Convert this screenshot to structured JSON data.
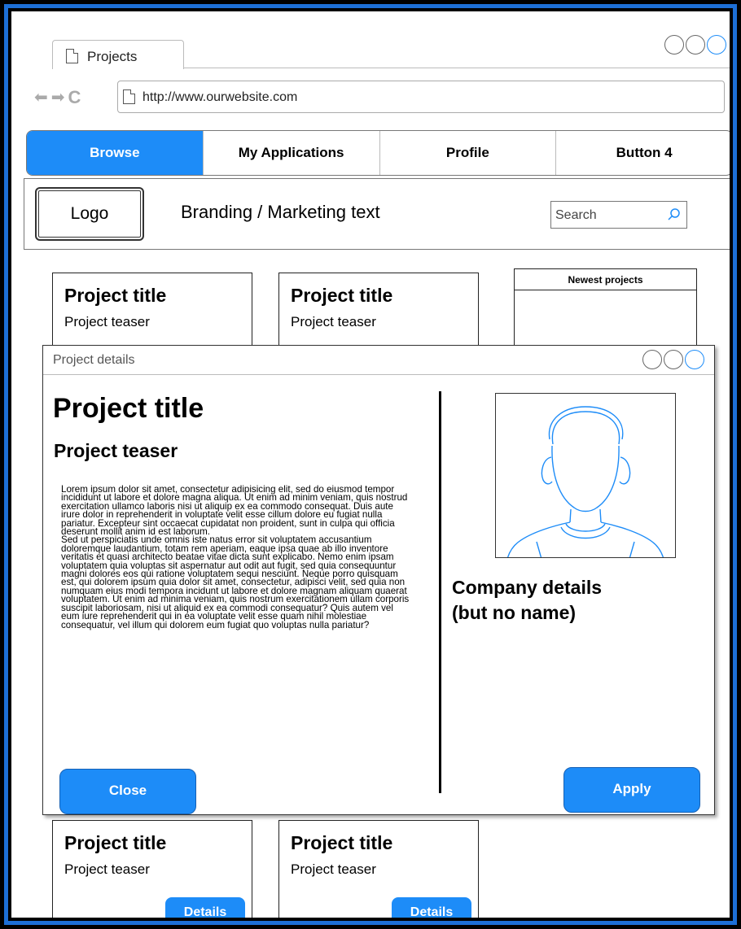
{
  "browser": {
    "tab_label": "Projects",
    "url": "http://www.ourwebsite.com",
    "back_glyph": "⬅",
    "forward_glyph": "➡",
    "reload_glyph": "C"
  },
  "navbar": {
    "items": [
      {
        "label": "Browse",
        "active": true
      },
      {
        "label": "My Applications",
        "active": false
      },
      {
        "label": "Profile",
        "active": false
      },
      {
        "label": "Button 4",
        "active": false
      }
    ]
  },
  "header": {
    "logo": "Logo",
    "branding": "Branding / Marketing text",
    "search_placeholder": "Search"
  },
  "cards": {
    "top": [
      {
        "title": "Project title",
        "teaser": "Project teaser"
      },
      {
        "title": "Project title",
        "teaser": "Project teaser"
      }
    ],
    "bottom": [
      {
        "title": "Project title",
        "teaser": "Project teaser",
        "button": "Details"
      },
      {
        "title": "Project title",
        "teaser": "Project teaser",
        "button": "Details"
      }
    ]
  },
  "newest": {
    "title": "Newest projects"
  },
  "modal": {
    "window_title": "Project details",
    "title": "Project title",
    "teaser": "Project teaser",
    "body_1": "Lorem ipsum dolor sit amet, consectetur adipisicing elit, sed do eiusmod tempor incididunt ut labore et dolore magna aliqua. Ut enim ad minim veniam, quis nostrud exercitation ullamco laboris nisi ut aliquip ex ea commodo consequat. Duis aute irure dolor in reprehenderit in voluptate velit esse cillum dolore eu fugiat nulla pariatur. Excepteur sint occaecat cupidatat non proident, sunt in culpa qui officia deserunt mollit anim id est laborum.",
    "body_2": "Sed ut perspiciatis unde omnis iste natus error sit voluptatem accusantium doloremque laudantium, totam rem aperiam, eaque ipsa quae ab illo inventore veritatis et quasi architecto beatae vitae dicta sunt explicabo. Nemo enim ipsam voluptatem quia voluptas sit aspernatur aut odit aut fugit, sed quia consequuntur magni dolores eos qui ratione voluptatem sequi nesciunt. Neque porro quisquam est, qui dolorem ipsum quia dolor sit amet, consectetur, adipisci velit, sed quia non numquam eius modi tempora incidunt ut labore et dolore magnam aliquam quaerat voluptatem. Ut enim ad minima veniam, quis nostrum exercitationem ullam corporis suscipit laboriosam, nisi ut aliquid ex ea commodi consequatur? Quis autem vel eum iure reprehenderit qui in ea voluptate velit esse quam nihil molestiae consequatur, vel illum qui dolorem eum fugiat quo voluptas nulla pariatur?",
    "company_line_1": "Company details",
    "company_line_2": "(but no name)",
    "close_label": "Close",
    "apply_label": "Apply"
  },
  "colors": {
    "accent": "#1d8cf8",
    "frame": "#1d6fd6"
  },
  "icons": [
    "document-icon",
    "back-arrow-icon",
    "forward-arrow-icon",
    "reload-icon",
    "search-icon",
    "window-control-icon",
    "user-avatar-icon"
  ]
}
